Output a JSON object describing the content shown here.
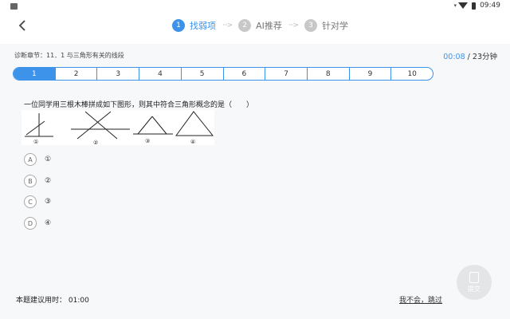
{
  "status_bar": {
    "time": "09:49"
  },
  "steps": [
    {
      "num": "1",
      "label": "找弱项",
      "active": true
    },
    {
      "num": "2",
      "label": "AI推荐",
      "active": false
    },
    {
      "num": "3",
      "label": "针对学",
      "active": false
    }
  ],
  "arrow": "···>",
  "chapter": "诊断章节：11．1 与三角形有关的线段",
  "timer": {
    "current": "00:08",
    "total": " / 23分钟"
  },
  "numbers": [
    "1",
    "2",
    "3",
    "4",
    "5",
    "6",
    "7",
    "8",
    "9",
    "10"
  ],
  "question": "一位同学用三根木棒拼成如下图形，则其中符合三角形概念的是（　　）",
  "figure_labels": [
    "①",
    "②",
    "③",
    "④"
  ],
  "options": [
    {
      "letter": "A",
      "text": "①"
    },
    {
      "letter": "B",
      "text": "②"
    },
    {
      "letter": "C",
      "text": "③"
    },
    {
      "letter": "D",
      "text": "④"
    }
  ],
  "suggest_time": "本题建议用时：  01:00",
  "skip": "我不会，跳过",
  "submit": "提交",
  "colors": {
    "accent": "#3d92ea",
    "inactive": "#c8c8c8",
    "panel": "#f7f8fa"
  }
}
